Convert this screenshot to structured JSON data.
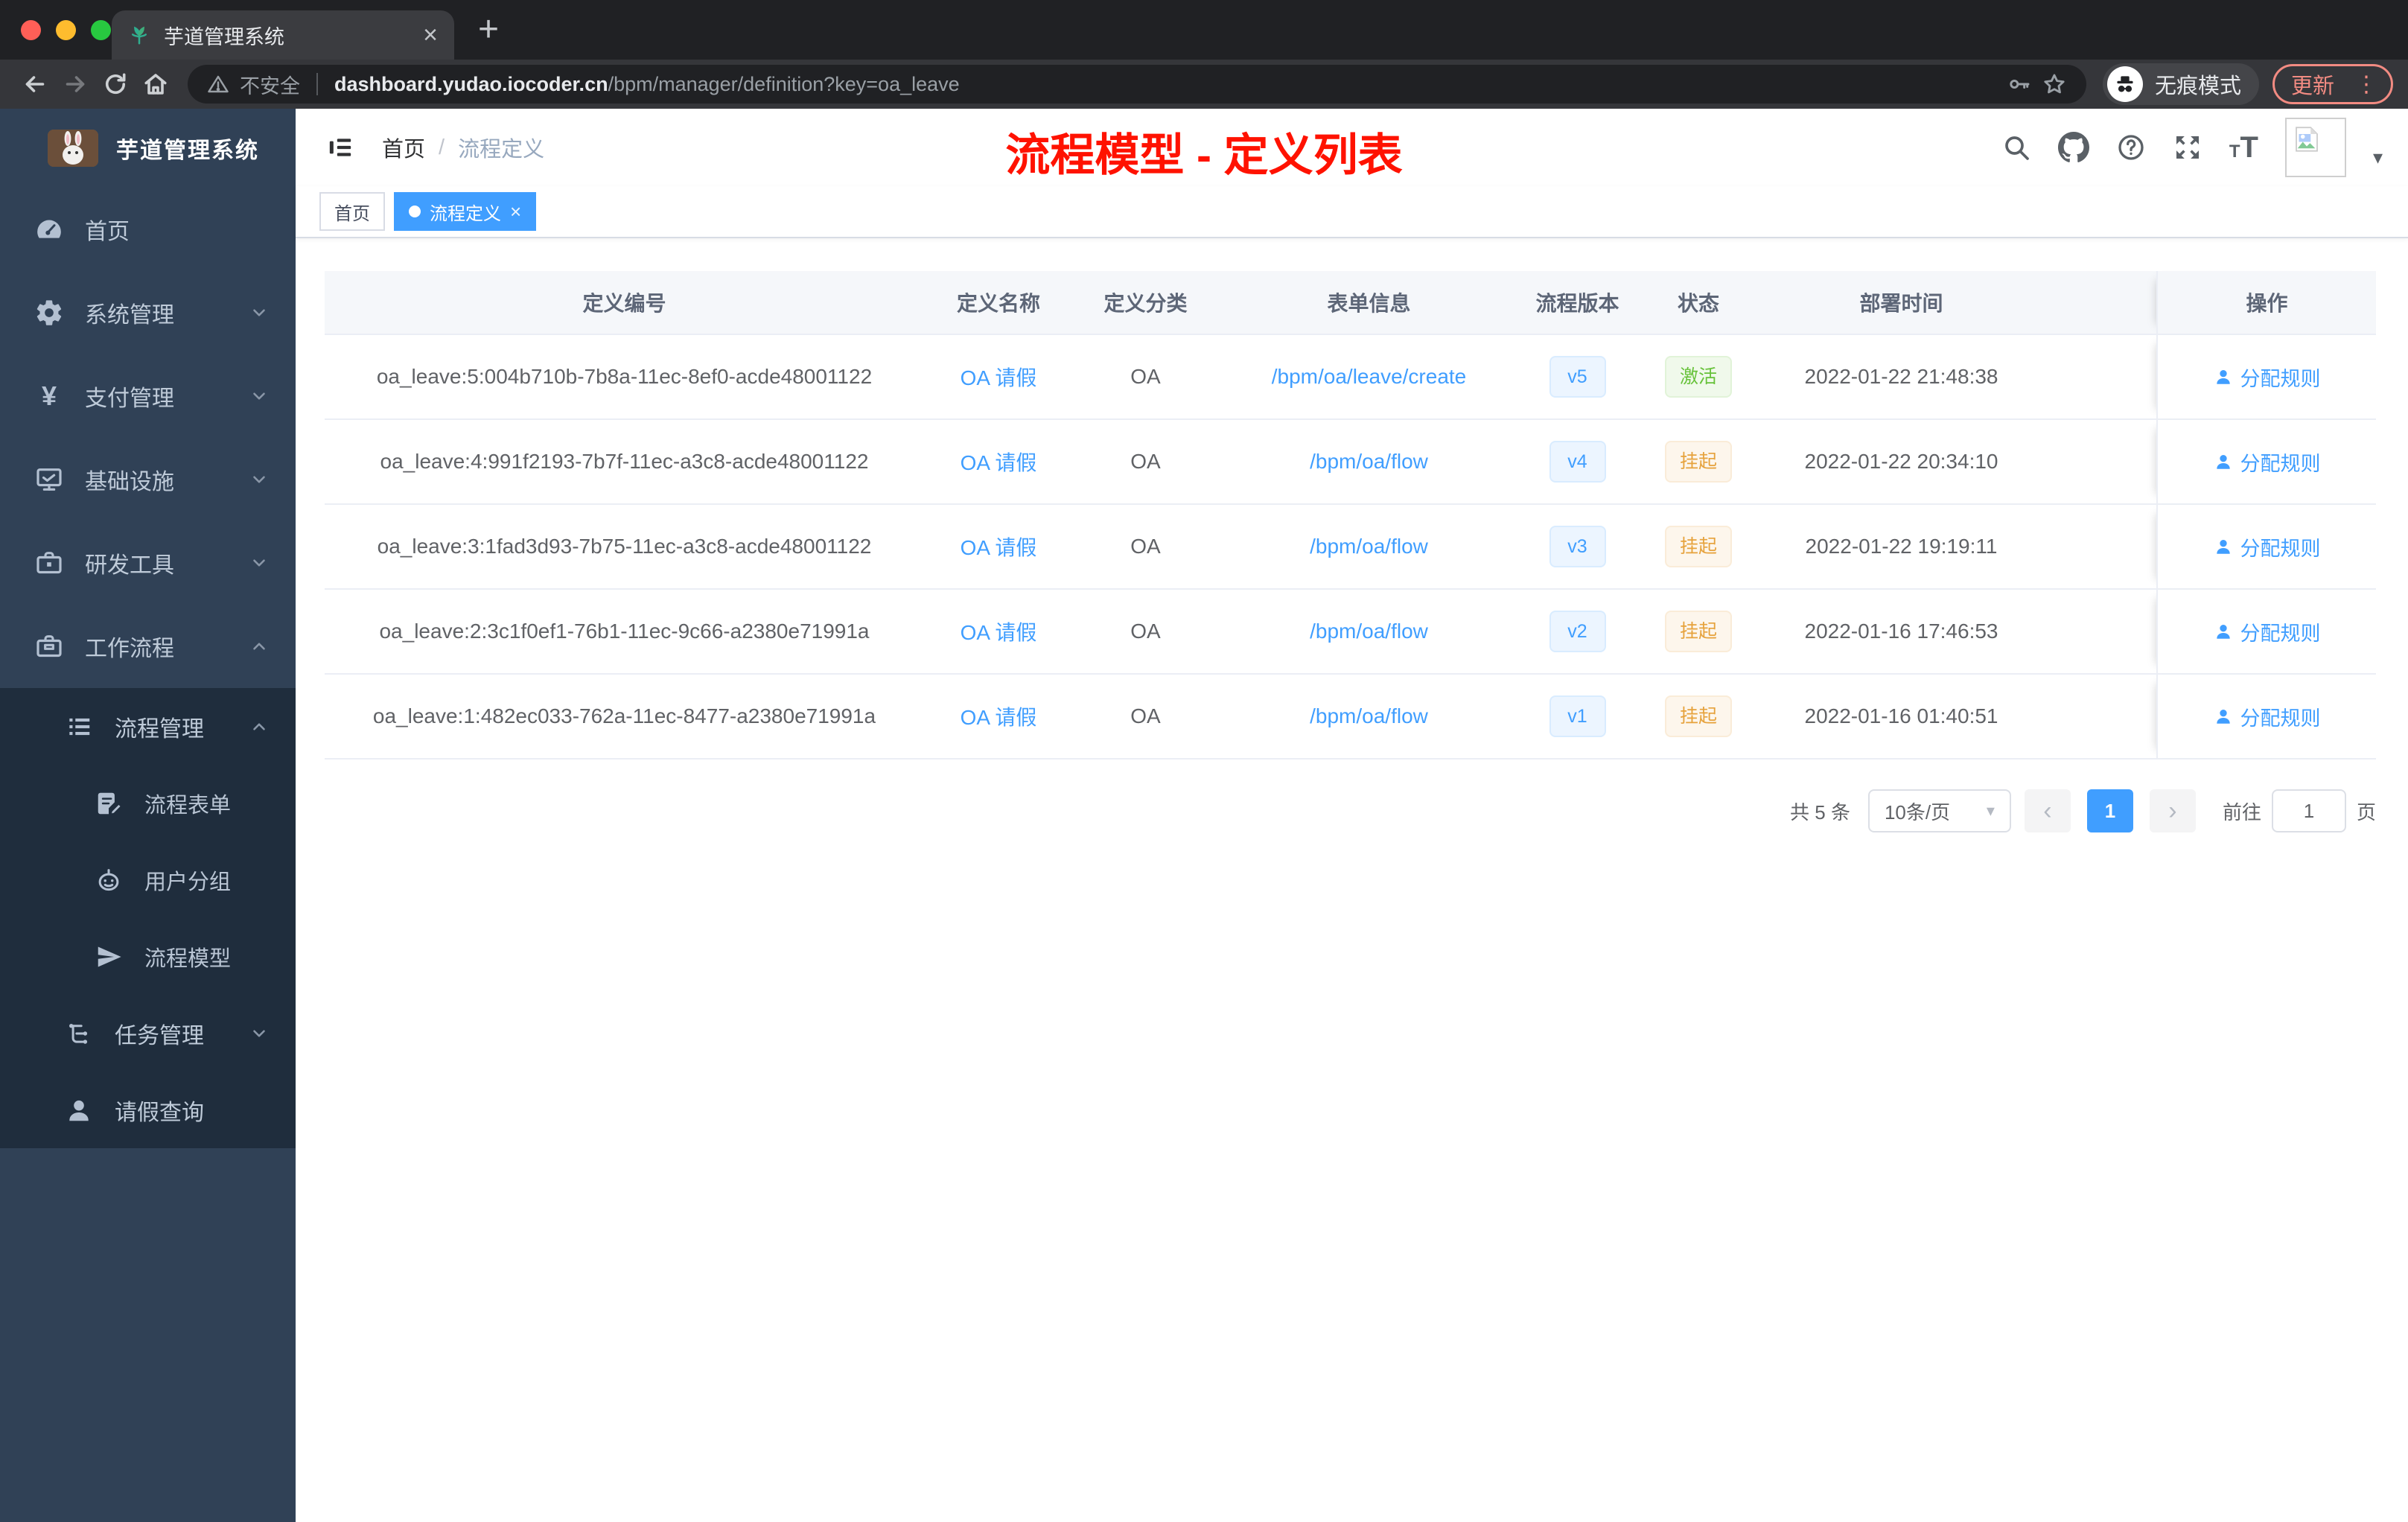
{
  "colors": {
    "accent": "#409eff",
    "success": "#67c23a",
    "warning": "#e6a23c",
    "annotation_red": "#ff1200",
    "sidebar_bg": "#304156",
    "submenu_bg": "#1f2d3d",
    "chrome_frame": "#202124",
    "chrome_toolbar": "#35363a",
    "update_red": "#f28b82"
  },
  "icons": {
    "tab-favicon": "green-sprout-plant",
    "toolbar": [
      "back-arrow",
      "forward-arrow",
      "reload",
      "home",
      "warning-triangle",
      "key",
      "star",
      "incognito",
      "kebab-menu"
    ],
    "navbar": [
      "hamburger-fold",
      "search",
      "github",
      "help-circle",
      "fullscreen",
      "font-size",
      "broken-image",
      "caret-down"
    ],
    "sidebar": [
      "dashboard-gauge",
      "gear",
      "yen",
      "monitor",
      "toolbox",
      "briefcase",
      "list-tree",
      "form-edit",
      "robot",
      "paper-plane",
      "org-tree",
      "person"
    ]
  },
  "browser": {
    "tab_title": "芋道管理系统",
    "security_label": "不安全",
    "url_host": "dashboard.yudao.iocoder.cn",
    "url_path": "/bpm/manager/definition?key=oa_leave",
    "incognito_label": "无痕模式",
    "update_label": "更新"
  },
  "sidebar": {
    "logo_title": "芋道管理系统",
    "items": [
      {
        "label": "首页"
      },
      {
        "label": "系统管理"
      },
      {
        "label": "支付管理"
      },
      {
        "label": "基础设施"
      },
      {
        "label": "研发工具"
      },
      {
        "label": "工作流程"
      },
      {
        "label": "流程管理"
      },
      {
        "label": "流程表单"
      },
      {
        "label": "用户分组"
      },
      {
        "label": "流程模型"
      },
      {
        "label": "任务管理"
      },
      {
        "label": "请假查询"
      }
    ]
  },
  "header": {
    "breadcrumb_home": "首页",
    "breadcrumb_sep": "/",
    "breadcrumb_current": "流程定义",
    "annotation": "流程模型 - 定义列表"
  },
  "tags": {
    "home": "首页",
    "active": "流程定义",
    "close": "×"
  },
  "table": {
    "columns": [
      "定义编号",
      "定义名称",
      "定义分类",
      "表单信息",
      "流程版本",
      "状态",
      "部署时间",
      "操作"
    ],
    "rows": [
      {
        "id": "oa_leave:5:004b710b-7b8a-11ec-8ef0-acde48001122",
        "name": "OA 请假",
        "category": "OA",
        "form": "/bpm/oa/leave/create",
        "version": "v5",
        "status": "激活",
        "deployed": "2022-01-22 21:48:38",
        "action": "分配规则"
      },
      {
        "id": "oa_leave:4:991f2193-7b7f-11ec-a3c8-acde48001122",
        "name": "OA 请假",
        "category": "OA",
        "form": "/bpm/oa/flow",
        "version": "v4",
        "status": "挂起",
        "deployed": "2022-01-22 20:34:10",
        "action": "分配规则"
      },
      {
        "id": "oa_leave:3:1fad3d93-7b75-11ec-a3c8-acde48001122",
        "name": "OA 请假",
        "category": "OA",
        "form": "/bpm/oa/flow",
        "version": "v3",
        "status": "挂起",
        "deployed": "2022-01-22 19:19:11",
        "action": "分配规则"
      },
      {
        "id": "oa_leave:2:3c1f0ef1-76b1-11ec-9c66-a2380e71991a",
        "name": "OA 请假",
        "category": "OA",
        "form": "/bpm/oa/flow",
        "version": "v2",
        "status": "挂起",
        "deployed": "2022-01-16 17:46:53",
        "action": "分配规则"
      },
      {
        "id": "oa_leave:1:482ec033-762a-11ec-8477-a2380e71991a",
        "name": "OA 请假",
        "category": "OA",
        "form": "/bpm/oa/flow",
        "version": "v1",
        "status": "挂起",
        "deployed": "2022-01-16 01:40:51",
        "action": "分配规则"
      }
    ]
  },
  "pagination": {
    "total": "共 5 条",
    "page_size": "10条/页",
    "current_page": "1",
    "goto_label": "前往",
    "goto_value": "1",
    "page_unit": "页"
  }
}
